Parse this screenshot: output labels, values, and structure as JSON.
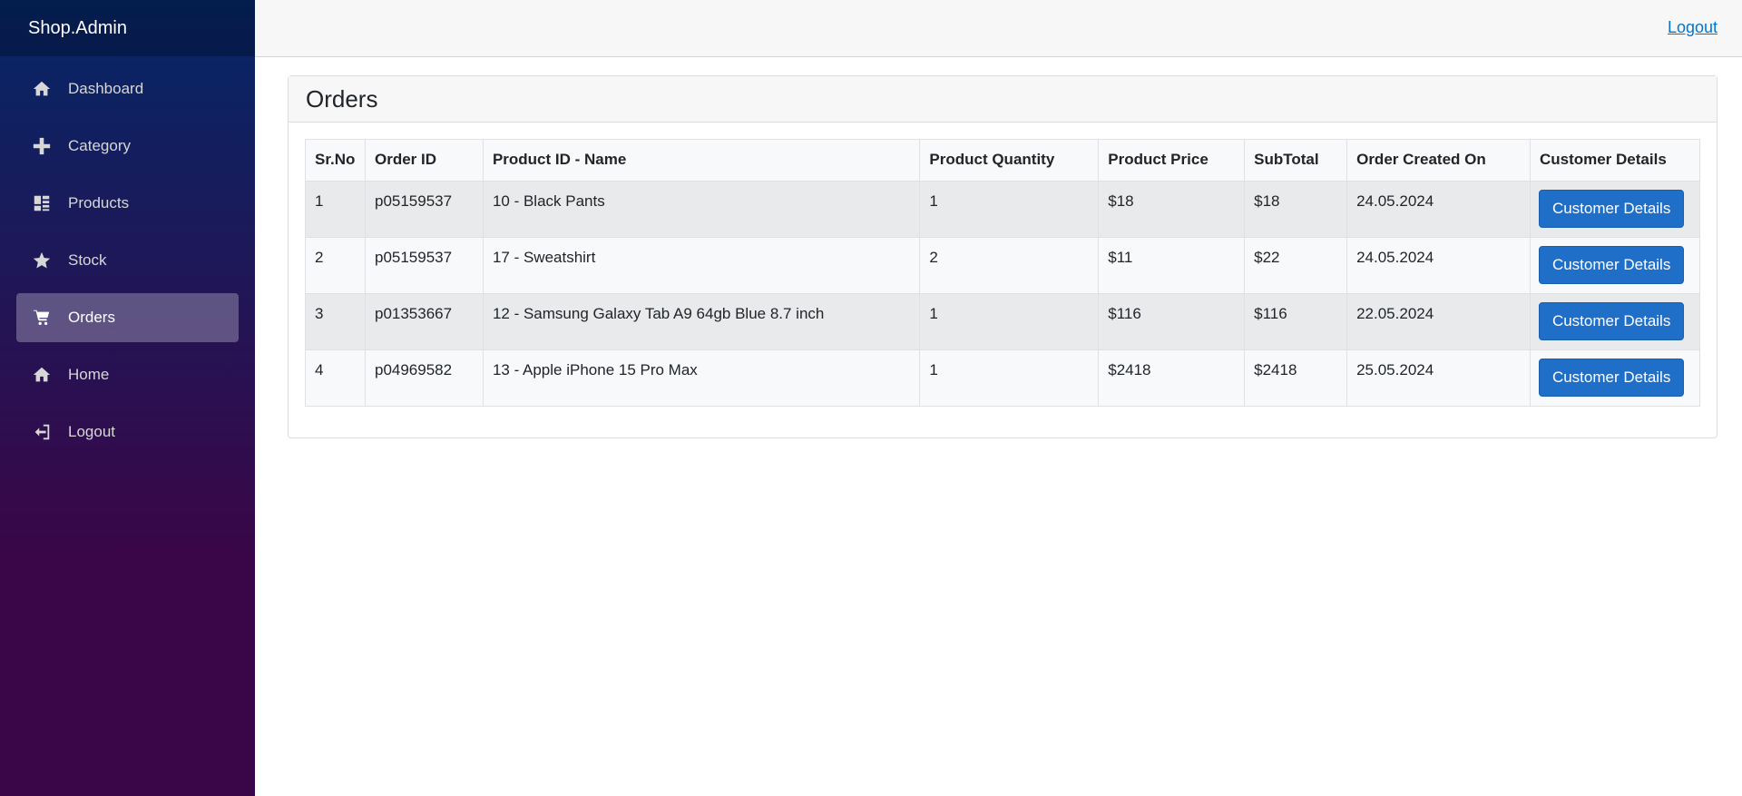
{
  "sidebar": {
    "brand": "Shop.Admin",
    "items": [
      {
        "label": "Dashboard",
        "icon": "home-icon"
      },
      {
        "label": "Category",
        "icon": "plus-icon"
      },
      {
        "label": "Products",
        "icon": "dashboard-grid-icon"
      },
      {
        "label": "Stock",
        "icon": "star-icon"
      },
      {
        "label": "Orders",
        "icon": "cart-icon",
        "active": true
      },
      {
        "label": "Home",
        "icon": "home-icon"
      },
      {
        "label": "Logout",
        "icon": "logout-icon"
      }
    ]
  },
  "topbar": {
    "logout_label": "Logout"
  },
  "orders": {
    "title": "Orders",
    "columns": [
      "Sr.No",
      "Order ID",
      "Product ID - Name",
      "Product Quantity",
      "Product Price",
      "SubTotal",
      "Order Created On",
      "Customer Details"
    ],
    "rows": [
      {
        "srno": "1",
        "order_id": "p05159537",
        "product": "10 - Black Pants",
        "qty": "1",
        "price": "$18",
        "subtotal": "$18",
        "created": "24.05.2024",
        "action": "Customer Details"
      },
      {
        "srno": "2",
        "order_id": "p05159537",
        "product": "17 - Sweatshirt",
        "qty": "2",
        "price": "$11",
        "subtotal": "$22",
        "created": "24.05.2024",
        "action": "Customer Details"
      },
      {
        "srno": "3",
        "order_id": "p01353667",
        "product": "12 - Samsung Galaxy Tab A9 64gb Blue 8.7 inch",
        "qty": "1",
        "price": "$116",
        "subtotal": "$116",
        "created": "22.05.2024",
        "action": "Customer Details"
      },
      {
        "srno": "4",
        "order_id": "p04969582",
        "product": "13 - Apple iPhone 15 Pro Max",
        "qty": "1",
        "price": "$2418",
        "subtotal": "$2418",
        "created": "25.05.2024",
        "action": "Customer Details"
      }
    ]
  },
  "colors": {
    "sidebar_top": "#052767",
    "sidebar_bottom": "#3a0647",
    "primary_button": "#1f6fc9",
    "link": "#0077cc"
  }
}
